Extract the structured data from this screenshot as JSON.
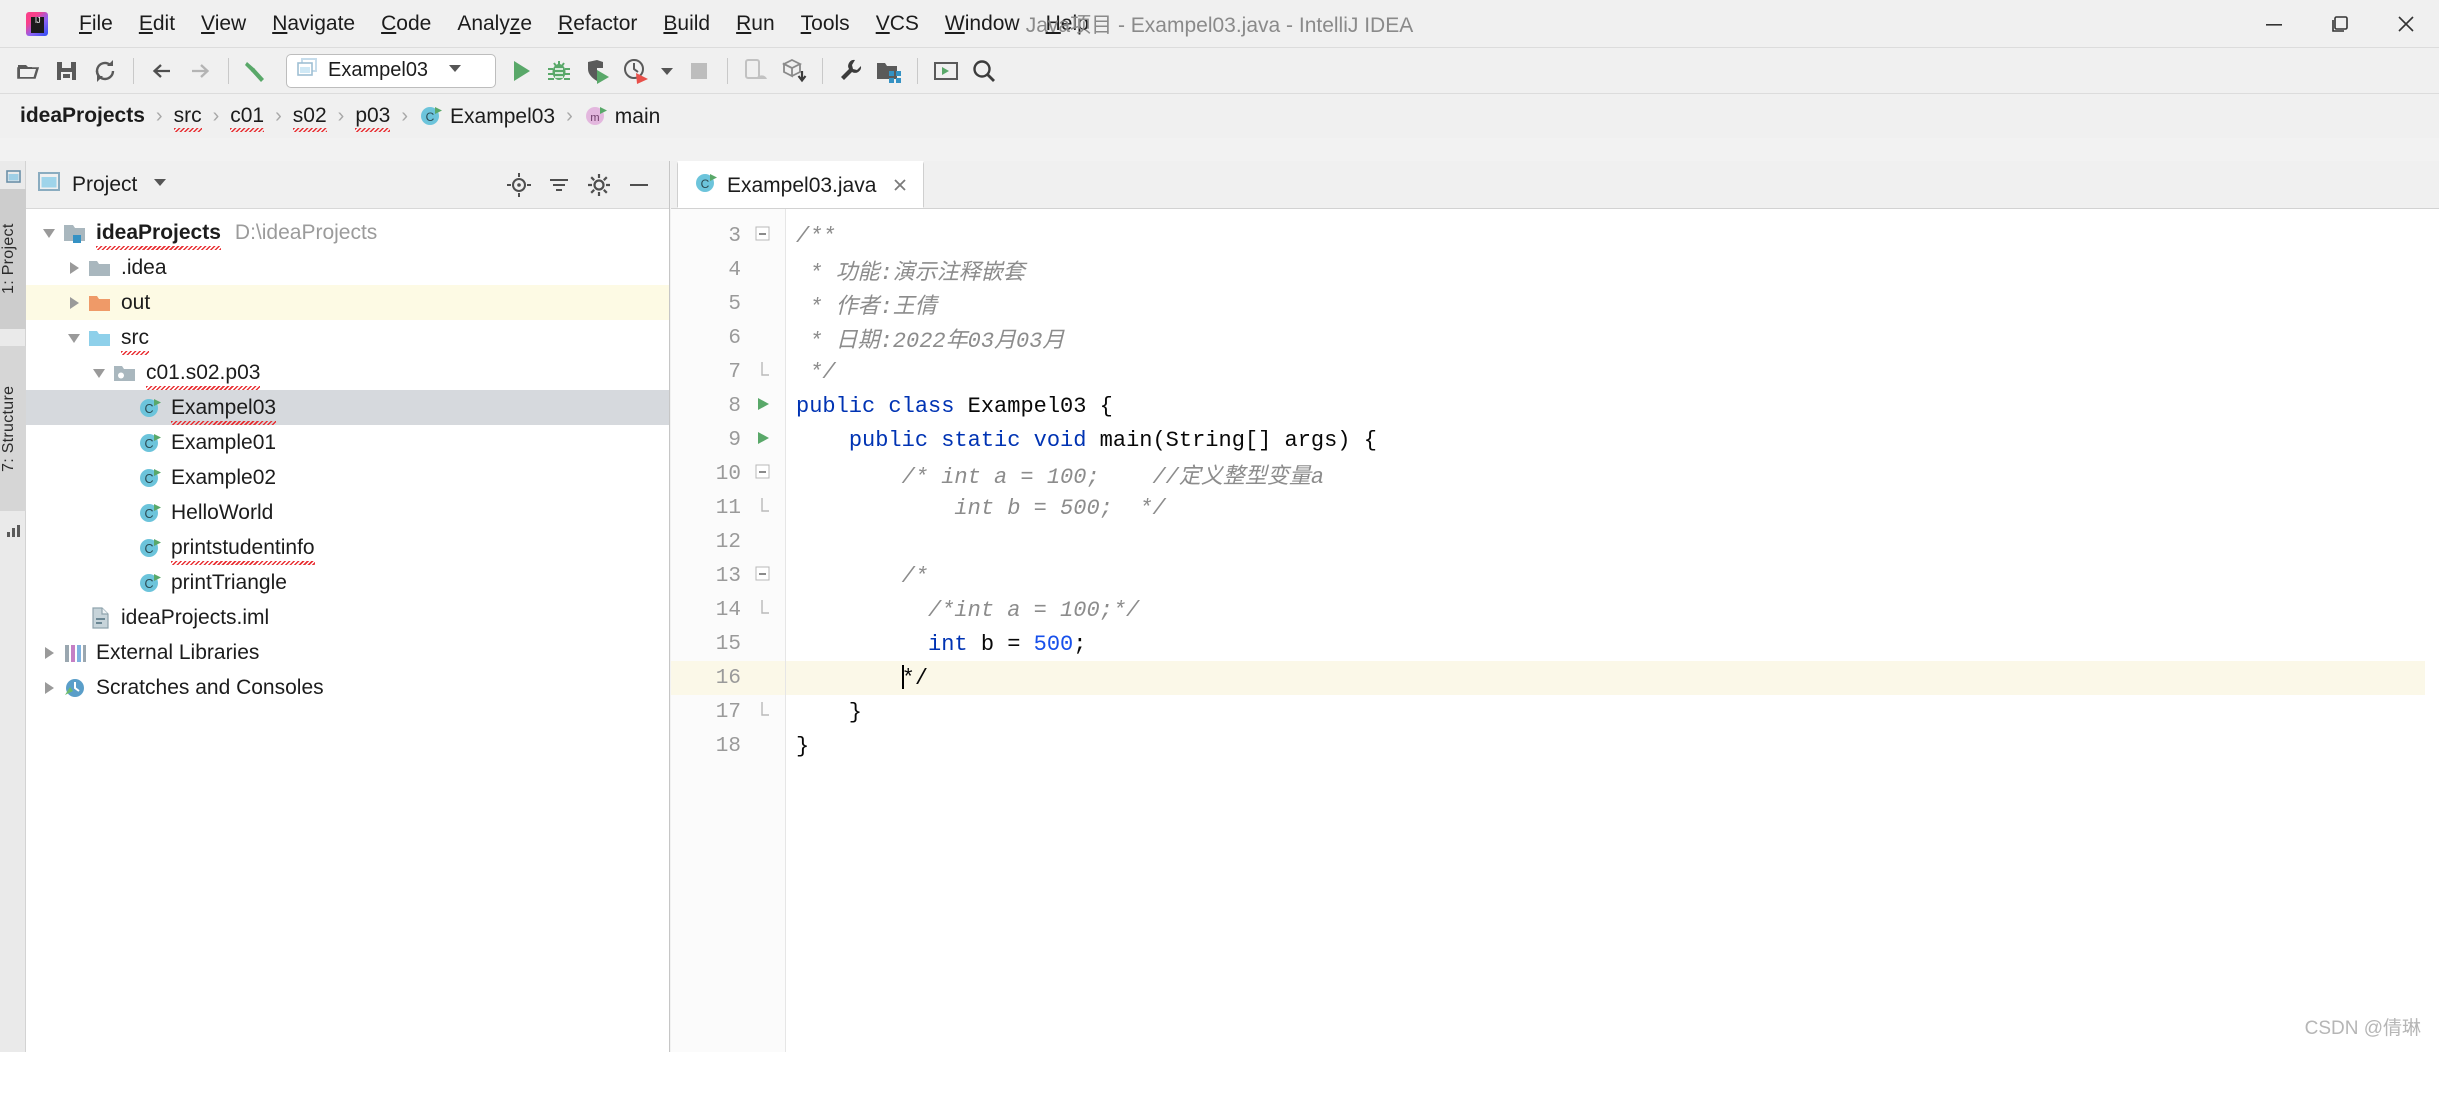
{
  "window": {
    "title": "Java项目 - Exampel03.java - IntelliJ IDEA",
    "logo_icon": "intellij-idea-logo",
    "minimize_label": "minimize-icon",
    "maximize_label": "maximize-icon",
    "close_label": "close-icon"
  },
  "menu": {
    "items": [
      {
        "label": "File",
        "mnemonic": "F"
      },
      {
        "label": "Edit",
        "mnemonic": "E"
      },
      {
        "label": "View",
        "mnemonic": "V"
      },
      {
        "label": "Navigate",
        "mnemonic": "N"
      },
      {
        "label": "Code",
        "mnemonic": "C"
      },
      {
        "label": "Analyze",
        "mnemonic": "z"
      },
      {
        "label": "Refactor",
        "mnemonic": "R"
      },
      {
        "label": "Build",
        "mnemonic": "B"
      },
      {
        "label": "Run",
        "mnemonic": "R"
      },
      {
        "label": "Tools",
        "mnemonic": "T"
      },
      {
        "label": "VCS",
        "mnemonic": "V"
      },
      {
        "label": "Window",
        "mnemonic": "W"
      },
      {
        "label": "Help",
        "mnemonic": "H"
      }
    ]
  },
  "toolbar": {
    "icons": [
      "open-project-icon",
      "save-all-icon",
      "sync-refresh-icon",
      "navigate-back-icon",
      "navigate-forward-icon",
      "build-hammer-icon"
    ],
    "run_config": {
      "name": "Exampel03",
      "icon": "run-config-icon",
      "dropdown_icon": "chevron-down-icon"
    },
    "run_icons": [
      "run-icon",
      "debug-icon",
      "run-with-coverage-icon",
      "profile-icon",
      "profile-dropdown-icon",
      "stop-icon"
    ],
    "right_icons": [
      "avd-manager-icon",
      "sdk-manager-icon",
      "settings-wrench-icon",
      "project-structure-icon",
      "terminal-icon",
      "search-everywhere-icon"
    ]
  },
  "breadcrumb": {
    "items": [
      {
        "label": "ideaProjects",
        "bold": true,
        "icon": "",
        "spell_error": false
      },
      {
        "label": "src",
        "bold": false,
        "icon": "",
        "spell_error": true
      },
      {
        "label": "c01",
        "bold": false,
        "icon": "",
        "spell_error": true
      },
      {
        "label": "s02",
        "bold": false,
        "icon": "",
        "spell_error": true
      },
      {
        "label": "p03",
        "bold": false,
        "icon": "",
        "spell_error": true
      },
      {
        "label": "Exampel03",
        "bold": false,
        "icon": "java-class-icon",
        "spell_error": false
      },
      {
        "label": "main",
        "bold": false,
        "icon": "java-method-icon",
        "spell_error": false
      }
    ],
    "separator": "›"
  },
  "rail": {
    "buttons": [
      {
        "label": "1: Project",
        "selected": true,
        "icon": "project-window-icon"
      },
      {
        "label": "7: Structure",
        "selected": false,
        "icon": "structure-icon"
      }
    ],
    "bottom_icon": "bar-chart-icon"
  },
  "project_panel": {
    "title": "Project",
    "title_icon": "project-window-icon",
    "dropdown_icon": "chevron-down-icon",
    "header_buttons": [
      "locate-target-icon",
      "collapse-all-icon",
      "settings-gear-icon",
      "hide-icon"
    ],
    "tree": [
      {
        "label": "ideaProjects",
        "sub": "D:\\ideaProjects",
        "indent": 0,
        "twisty": "open",
        "icon": "module-folder-icon",
        "bold": true,
        "selected": false,
        "highlight": false,
        "spell_error": true
      },
      {
        "label": ".idea",
        "sub": "",
        "indent": 1,
        "twisty": "closed",
        "icon": "folder-gray-icon",
        "bold": false,
        "selected": false,
        "highlight": false,
        "spell_error": false
      },
      {
        "label": "out",
        "sub": "",
        "indent": 1,
        "twisty": "closed",
        "icon": "folder-orange-icon",
        "bold": false,
        "selected": false,
        "highlight": true,
        "spell_error": false
      },
      {
        "label": "src",
        "sub": "",
        "indent": 1,
        "twisty": "open",
        "icon": "folder-source-icon",
        "bold": false,
        "selected": false,
        "highlight": false,
        "spell_error": true
      },
      {
        "label": "c01.s02.p03",
        "sub": "",
        "indent": 2,
        "twisty": "open",
        "icon": "package-icon",
        "bold": false,
        "selected": false,
        "highlight": false,
        "spell_error": true
      },
      {
        "label": "Exampel03",
        "sub": "",
        "indent": 3,
        "twisty": "none",
        "icon": "java-class-icon",
        "bold": false,
        "selected": true,
        "highlight": false,
        "spell_error": true
      },
      {
        "label": "Example01",
        "sub": "",
        "indent": 3,
        "twisty": "none",
        "icon": "java-class-icon",
        "bold": false,
        "selected": false,
        "highlight": false,
        "spell_error": false
      },
      {
        "label": "Example02",
        "sub": "",
        "indent": 3,
        "twisty": "none",
        "icon": "java-class-icon",
        "bold": false,
        "selected": false,
        "highlight": false,
        "spell_error": false
      },
      {
        "label": "HelloWorld",
        "sub": "",
        "indent": 3,
        "twisty": "none",
        "icon": "java-class-icon",
        "bold": false,
        "selected": false,
        "highlight": false,
        "spell_error": false
      },
      {
        "label": "printstudentinfo",
        "sub": "",
        "indent": 3,
        "twisty": "none",
        "icon": "java-class-icon",
        "bold": false,
        "selected": false,
        "highlight": false,
        "spell_error": true
      },
      {
        "label": "printTriangle",
        "sub": "",
        "indent": 3,
        "twisty": "none",
        "icon": "java-class-icon",
        "bold": false,
        "selected": false,
        "highlight": false,
        "spell_error": false
      },
      {
        "label": "ideaProjects.iml",
        "sub": "",
        "indent": 1,
        "twisty": "none",
        "icon": "iml-file-icon",
        "bold": false,
        "selected": false,
        "highlight": false,
        "spell_error": false
      },
      {
        "label": "External Libraries",
        "sub": "",
        "indent": 0,
        "twisty": "closed",
        "icon": "libraries-icon",
        "bold": false,
        "selected": false,
        "highlight": false,
        "spell_error": false
      },
      {
        "label": "Scratches and Consoles",
        "sub": "",
        "indent": 0,
        "twisty": "closed",
        "icon": "scratches-icon",
        "bold": false,
        "selected": false,
        "highlight": false,
        "spell_error": false
      }
    ]
  },
  "editor": {
    "tab": {
      "label": "Exampel03.java",
      "icon": "java-class-icon",
      "close_icon": "close-icon"
    },
    "first_line_number": 3,
    "highlight_line": 16,
    "caret_line": 16,
    "lines": [
      {
        "n": 3,
        "gutter_mark": "fold-open",
        "tokens": [
          {
            "t": "/**",
            "c": "cmt"
          }
        ]
      },
      {
        "n": 4,
        "gutter_mark": "",
        "tokens": [
          {
            "t": " * 功能:演示注释嵌套",
            "c": "cmt"
          }
        ]
      },
      {
        "n": 5,
        "gutter_mark": "",
        "tokens": [
          {
            "t": " * 作者:王倩",
            "c": "cmt"
          }
        ]
      },
      {
        "n": 6,
        "gutter_mark": "",
        "tokens": [
          {
            "t": " * 日期:2022年03月03月",
            "c": "cmt"
          }
        ]
      },
      {
        "n": 7,
        "gutter_mark": "fold-end",
        "tokens": [
          {
            "t": " */",
            "c": "cmt"
          }
        ]
      },
      {
        "n": 8,
        "gutter_mark": "run",
        "tokens": [
          {
            "t": "public",
            "c": "kw"
          },
          {
            "t": " ",
            "c": "plain"
          },
          {
            "t": "class",
            "c": "kw"
          },
          {
            "t": " Exampel03 {",
            "c": "plain"
          }
        ]
      },
      {
        "n": 9,
        "gutter_mark": "run",
        "tokens": [
          {
            "t": "    ",
            "c": "plain"
          },
          {
            "t": "public",
            "c": "kw"
          },
          {
            "t": " ",
            "c": "plain"
          },
          {
            "t": "static",
            "c": "kw"
          },
          {
            "t": " ",
            "c": "plain"
          },
          {
            "t": "void",
            "c": "kw"
          },
          {
            "t": " main(String[] args) {",
            "c": "plain"
          }
        ]
      },
      {
        "n": 10,
        "gutter_mark": "fold-open",
        "tokens": [
          {
            "t": "        /* int a = 100;    //定义整型变量a",
            "c": "cmt"
          }
        ]
      },
      {
        "n": 11,
        "gutter_mark": "fold-end",
        "tokens": [
          {
            "t": "            int b = 500;  */",
            "c": "cmt"
          }
        ]
      },
      {
        "n": 12,
        "gutter_mark": "",
        "tokens": [
          {
            "t": "",
            "c": "plain"
          }
        ]
      },
      {
        "n": 13,
        "gutter_mark": "fold-open",
        "tokens": [
          {
            "t": "        /*",
            "c": "cmt"
          }
        ]
      },
      {
        "n": 14,
        "gutter_mark": "fold-end",
        "tokens": [
          {
            "t": "          /*int a = 100;*/",
            "c": "cmt"
          }
        ]
      },
      {
        "n": 15,
        "gutter_mark": "",
        "tokens": [
          {
            "t": "          ",
            "c": "plain"
          },
          {
            "t": "int",
            "c": "kw"
          },
          {
            "t": " b = ",
            "c": "plain"
          },
          {
            "t": "500",
            "c": "num"
          },
          {
            "t": ";",
            "c": "plain"
          }
        ]
      },
      {
        "n": 16,
        "gutter_mark": "",
        "tokens": [
          {
            "t": "        ",
            "c": "plain"
          },
          {
            "t": "*/",
            "c": "plain",
            "caret": true
          }
        ]
      },
      {
        "n": 17,
        "gutter_mark": "fold-end",
        "tokens": [
          {
            "t": "    }",
            "c": "plain"
          }
        ]
      },
      {
        "n": 18,
        "gutter_mark": "",
        "tokens": [
          {
            "t": "}",
            "c": "plain"
          }
        ]
      }
    ]
  },
  "watermark": "CSDN @倩琳",
  "colors": {
    "accent_blue": "#4a86c8",
    "keyword_blue": "#0033b3",
    "number_blue": "#1750eb",
    "comment_gray": "#8c8c8c",
    "selection_gray": "#d6d9dd",
    "line_highlight": "#fbf8e8",
    "row_highlight": "#fdfae4",
    "folder_orange": "#ef9a68",
    "folder_source": "#8ed0ea",
    "run_green": "#59a869",
    "spell_error_red": "#e8262a"
  }
}
